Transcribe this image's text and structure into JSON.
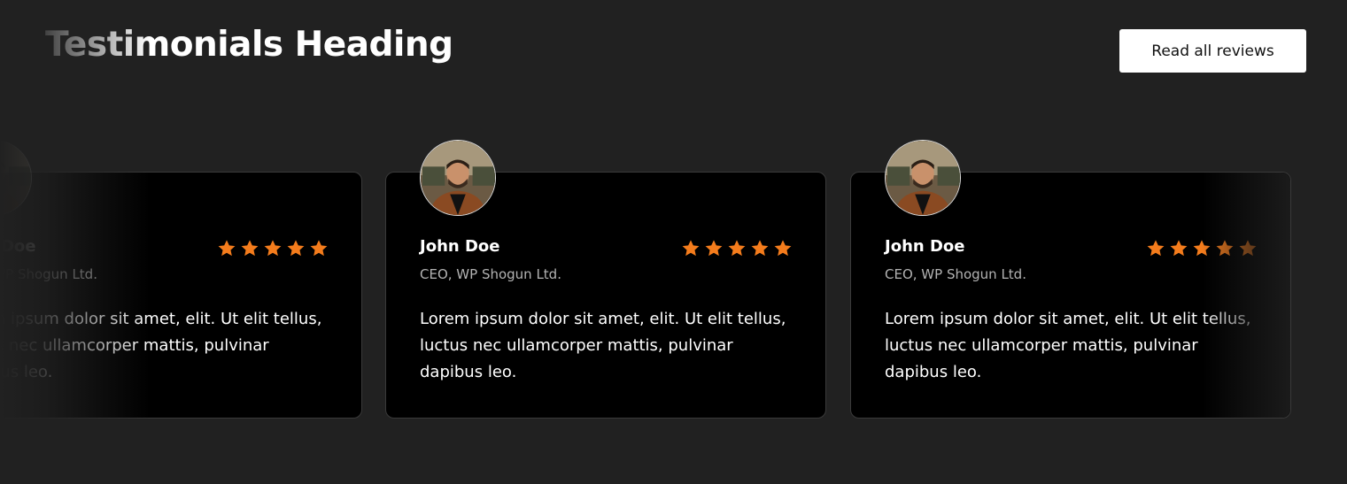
{
  "section": {
    "heading": "Testimonials Heading",
    "cta_label": "Read all reviews"
  },
  "colors": {
    "background": "#212121",
    "card": "#000000",
    "star": "#f47c1c",
    "button": "#ffffff"
  },
  "testimonials": [
    {
      "name": "John Doe",
      "role": "CEO, WP Shogun Ltd.",
      "quote": "Lorem ipsum dolor sit amet, elit. Ut elit tellus, luctus nec ullamcorper mattis, pulvinar dapibus leo.",
      "rating": 5
    },
    {
      "name": "John Doe",
      "role": "CEO, WP Shogun Ltd.",
      "quote": "Lorem ipsum dolor sit amet, elit. Ut elit tellus, luctus nec ullamcorper mattis, pulvinar dapibus leo.",
      "rating": 5
    },
    {
      "name": "John Doe",
      "role": "CEO, WP Shogun Ltd.",
      "quote": "Lorem ipsum dolor sit amet, elit. Ut elit tellus, luctus nec ullamcorper mattis, pulvinar dapibus leo.",
      "rating": 5
    }
  ]
}
